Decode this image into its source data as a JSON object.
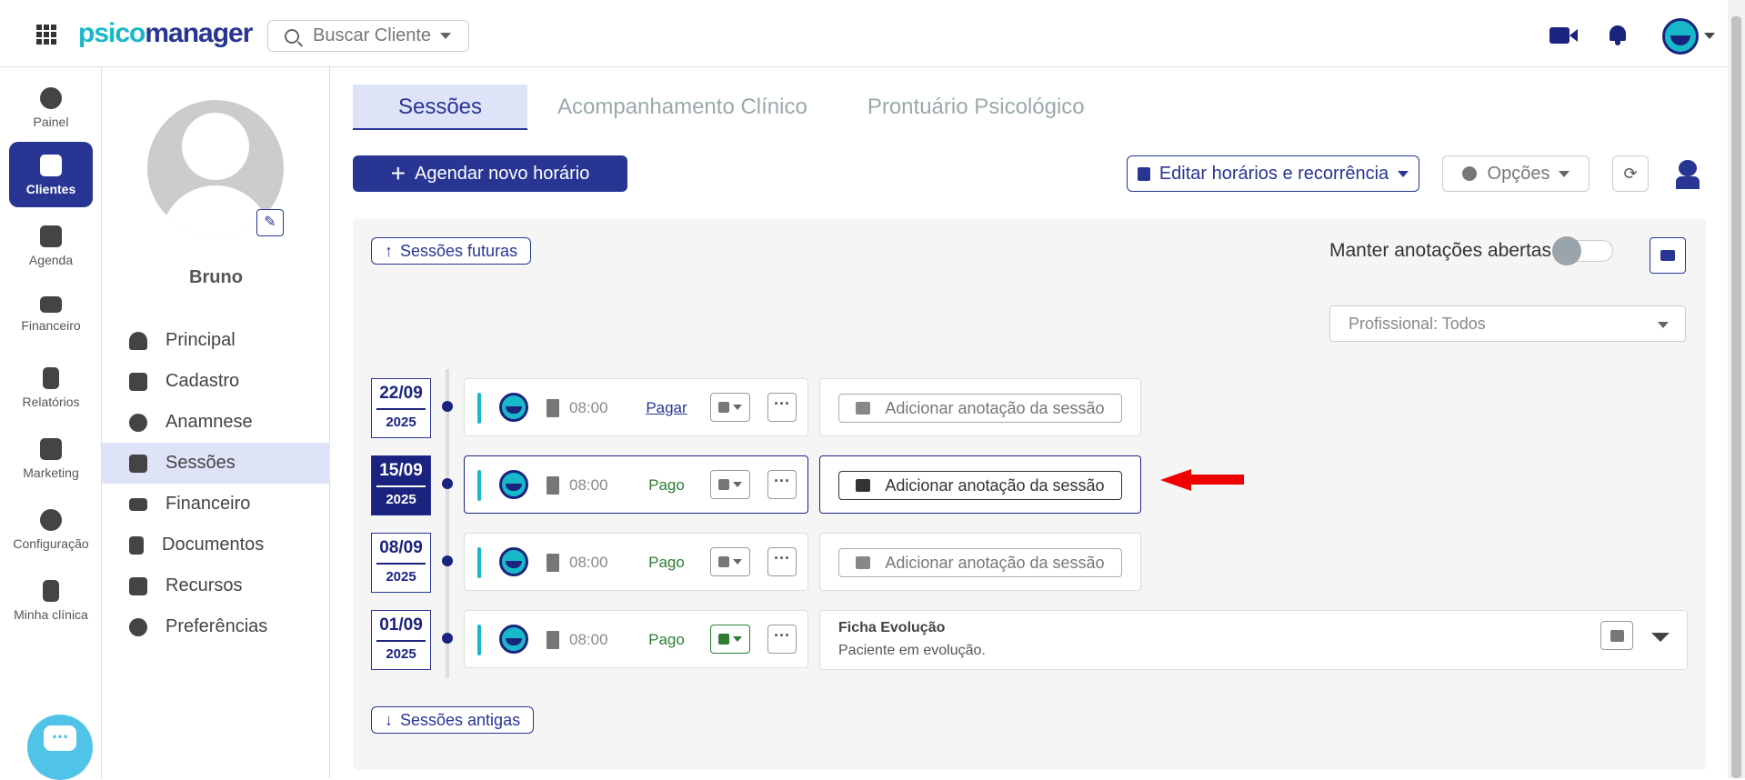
{
  "header": {
    "logo_part1": "psico",
    "logo_part2": "manager",
    "search_placeholder": "Buscar Cliente"
  },
  "rail": [
    {
      "label": "Painel",
      "icon": "dashboard-icon"
    },
    {
      "label": "Clientes",
      "icon": "users-icon",
      "active": true
    },
    {
      "label": "Agenda",
      "icon": "calendar-icon"
    },
    {
      "label": "Financeiro",
      "icon": "money-icon"
    },
    {
      "label": "Relatórios",
      "icon": "report-icon"
    },
    {
      "label": "Marketing",
      "icon": "megaphone-icon"
    },
    {
      "label": "Configuração",
      "icon": "gear-icon"
    },
    {
      "label": "Minha clínica",
      "icon": "building-icon"
    }
  ],
  "client": {
    "name": "Bruno",
    "menu": [
      {
        "label": "Principal",
        "icon": "user-icon"
      },
      {
        "label": "Cadastro",
        "icon": "edit-icon"
      },
      {
        "label": "Anamnese",
        "icon": "question-icon"
      },
      {
        "label": "Sessões",
        "icon": "briefcase-icon",
        "active": true
      },
      {
        "label": "Financeiro",
        "icon": "money-icon"
      },
      {
        "label": "Documentos",
        "icon": "document-icon"
      },
      {
        "label": "Recursos",
        "icon": "puzzle-icon"
      },
      {
        "label": "Preferências",
        "icon": "gear-icon"
      }
    ]
  },
  "tabs": [
    "Sessões",
    "Acompanhamento Clínico",
    "Prontuário Psicológico"
  ],
  "toolbar": {
    "new_schedule": "Agendar novo horário",
    "edit_schedule": "Editar horários e recorrência",
    "options": "Opções"
  },
  "sessions": {
    "future_label": "Sessões futuras",
    "past_label": "Sessões antigas",
    "keep_notes_label": "Manter anotações abertas",
    "professional_filter": "Profissional: Todos",
    "add_note_label": "Adicionar anotação da sessão",
    "items": [
      {
        "date": "22/09",
        "year": "2025",
        "time": "08:00",
        "payment": "Pagar",
        "status": "scheduled"
      },
      {
        "date": "15/09",
        "year": "2025",
        "time": "08:00",
        "payment": "Pago",
        "status": "scheduled",
        "active": true
      },
      {
        "date": "08/09",
        "year": "2025",
        "time": "08:00",
        "payment": "Pago",
        "status": "scheduled"
      },
      {
        "date": "01/09",
        "year": "2025",
        "time": "08:00",
        "payment": "Pago",
        "status": "attended"
      }
    ],
    "evolution": {
      "title": "Ficha Evolução",
      "text": "Paciente em evolução."
    }
  },
  "colors": {
    "brand": "#283593",
    "accent": "#18b8c9",
    "paid": "#2e7d32",
    "annotation_arrow": "#e00000"
  }
}
